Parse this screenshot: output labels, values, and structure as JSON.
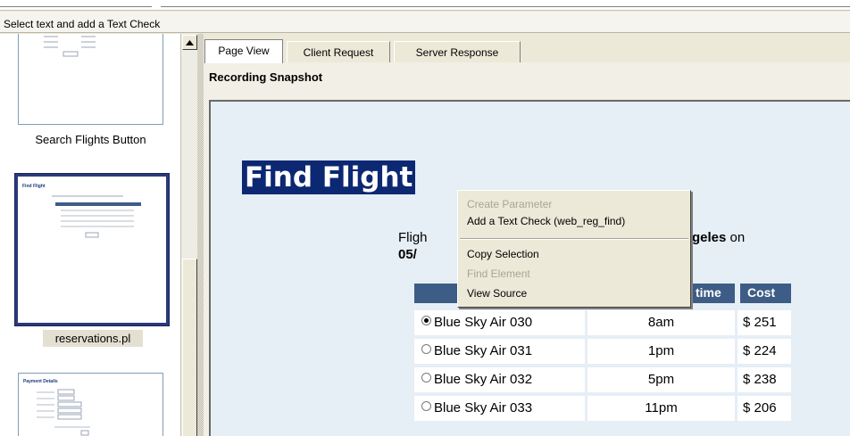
{
  "window_title": "Select text and add a Text Check",
  "thumbnails": [
    {
      "label": "Search Flights Button",
      "selected": false
    },
    {
      "label": "reservations.pl",
      "selected": true
    },
    {
      "label": "",
      "selected": false
    }
  ],
  "thumb_tiny": {
    "find_flight": "Find Flight",
    "payment_details": "Payment Details"
  },
  "scroll_up_icon": "triangle-up",
  "tabs": [
    {
      "label": "Page View",
      "active": true
    },
    {
      "label": "Client Request",
      "active": false
    },
    {
      "label": "Server Response",
      "active": false
    }
  ],
  "snapshot_label": "Recording Snapshot",
  "page": {
    "heading": "Find Flight",
    "line1_prefix": "Fligh",
    "line1_suffix_bold": "geles",
    "line1_suffix": " on",
    "line2_prefix": "05/",
    "table_headers": {
      "time": "time",
      "cost": "Cost"
    },
    "flights": [
      {
        "name": "Blue Sky Air 030",
        "time": "8am",
        "cost": "$ 251",
        "checked": true
      },
      {
        "name": "Blue Sky Air 031",
        "time": "1pm",
        "cost": "$ 224",
        "checked": false
      },
      {
        "name": "Blue Sky Air 032",
        "time": "5pm",
        "cost": "$ 238",
        "checked": false
      },
      {
        "name": "Blue Sky Air 033",
        "time": "11pm",
        "cost": "$ 206",
        "checked": false
      }
    ]
  },
  "context_menu": {
    "create_parameter": "Create Parameter",
    "add_text_check": "Add a Text Check (web_reg_find)",
    "copy_selection": "Copy Selection",
    "find_element": "Find Element",
    "view_source": "View Source"
  },
  "colors": {
    "heading_bg": "#0c2872",
    "table_header_bg": "#3e5d86",
    "page_bg": "#e6eef6"
  }
}
